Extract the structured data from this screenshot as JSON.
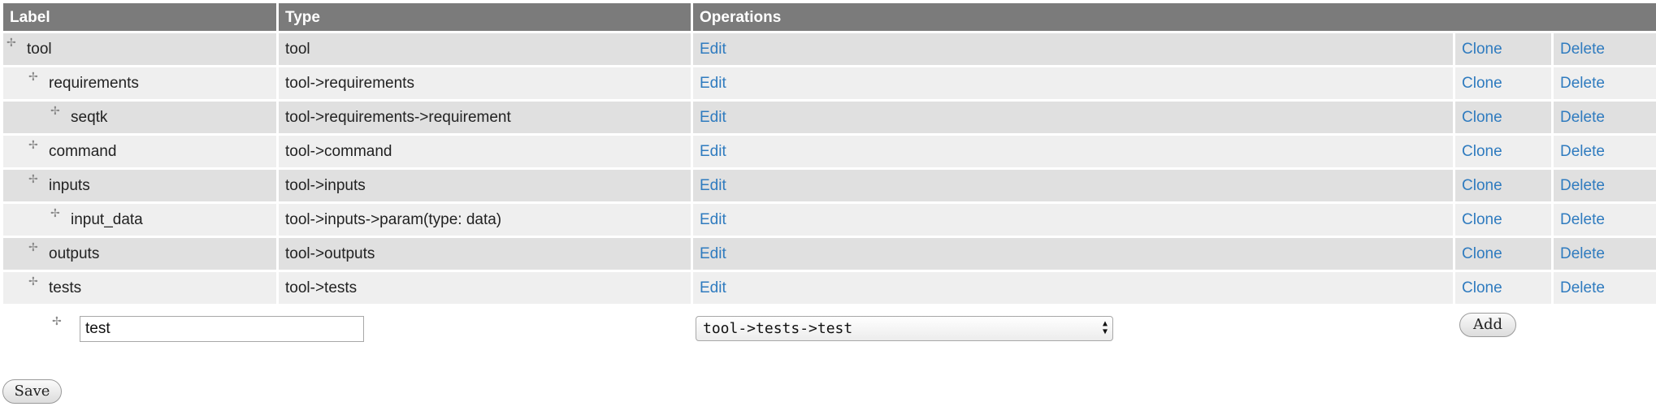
{
  "table": {
    "headers": {
      "label": "Label",
      "type": "Type",
      "operations": "Operations"
    },
    "rows": [
      {
        "label": "tool",
        "type": "tool",
        "depth": 0,
        "edit": "Edit",
        "clone": "Clone",
        "delete": "Delete"
      },
      {
        "label": "requirements",
        "type": "tool->requirements",
        "depth": 1,
        "edit": "Edit",
        "clone": "Clone",
        "delete": "Delete"
      },
      {
        "label": "seqtk",
        "type": "tool->requirements->requirement",
        "depth": 2,
        "edit": "Edit",
        "clone": "Clone",
        "delete": "Delete"
      },
      {
        "label": "command",
        "type": "tool->command",
        "depth": 1,
        "edit": "Edit",
        "clone": "Clone",
        "delete": "Delete"
      },
      {
        "label": "inputs",
        "type": "tool->inputs",
        "depth": 1,
        "edit": "Edit",
        "clone": "Clone",
        "delete": "Delete"
      },
      {
        "label": "input_data",
        "type": "tool->inputs->param(type: data)",
        "depth": 2,
        "edit": "Edit",
        "clone": "Clone",
        "delete": "Delete"
      },
      {
        "label": "outputs",
        "type": "tool->outputs",
        "depth": 1,
        "edit": "Edit",
        "clone": "Clone",
        "delete": "Delete"
      },
      {
        "label": "tests",
        "type": "tool->tests",
        "depth": 1,
        "edit": "Edit",
        "clone": "Clone",
        "delete": "Delete"
      }
    ]
  },
  "new_item": {
    "label_value": "test",
    "type_selected": "tool->tests->test",
    "add_label": "Add"
  },
  "save_label": "Save",
  "icons": {
    "drag_handle": "drag-handle-icon"
  },
  "colors": {
    "header_bg": "#7b7b7b",
    "row_dark": "#e0e0e0",
    "row_light": "#efefef",
    "link": "#2f7bbf"
  }
}
